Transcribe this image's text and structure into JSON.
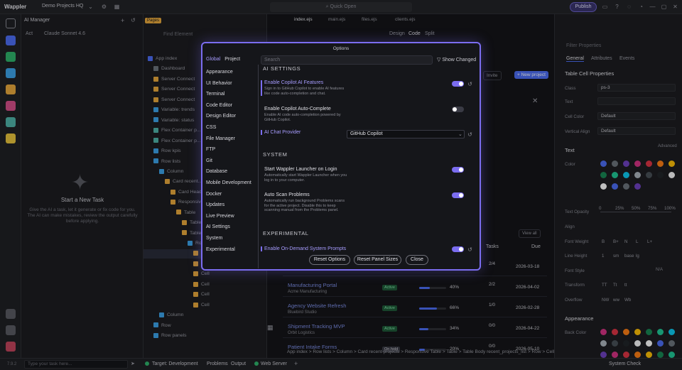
{
  "app": {
    "logo": "Wappler",
    "project": "Demo Projects HQ",
    "quick_open": "Quick Open",
    "publish": "Publish"
  },
  "ai_panel": {
    "title": "AI Manager",
    "mode": "Act",
    "model": "Claude Sonnet 4.6",
    "empty_title": "Start a New Task",
    "empty_desc": "Give the AI a task, let it generate or fix code for you. The AI can make mistakes, review the output carefully before applying.",
    "input_placeholder": "Type your task here..."
  },
  "tree": {
    "pages_badge": "Pages",
    "items": [
      {
        "label": "App index",
        "indent": 0
      },
      {
        "label": "Dashboard",
        "indent": 1
      },
      {
        "label": "Server Connect",
        "indent": 1
      },
      {
        "label": "Server Connect",
        "indent": 1
      },
      {
        "label": "Server Connect",
        "indent": 1
      },
      {
        "label": "Variable: trends",
        "indent": 1
      },
      {
        "label": "Variable: status",
        "indent": 1
      },
      {
        "label": "Flex Container p...",
        "indent": 1
      },
      {
        "label": "Flex Container p...",
        "indent": 1
      },
      {
        "label": "Row kpis",
        "indent": 1
      },
      {
        "label": "Row lists",
        "indent": 1
      },
      {
        "label": "Column",
        "indent": 2
      },
      {
        "label": "Card recent...",
        "indent": 3
      },
      {
        "label": "Card Head...",
        "indent": 4
      },
      {
        "label": "Responsive...",
        "indent": 4
      },
      {
        "label": "Table",
        "indent": 5
      },
      {
        "label": "Table He...",
        "indent": 6
      },
      {
        "label": "Table Bo...",
        "indent": 6
      },
      {
        "label": "Row",
        "indent": 7
      },
      {
        "label": "Cell",
        "indent": 8
      },
      {
        "label": "Cell",
        "indent": 8
      },
      {
        "label": "Cell",
        "indent": 8
      },
      {
        "label": "Cell",
        "indent": 8
      },
      {
        "label": "Cell",
        "indent": 8
      },
      {
        "label": "Cell",
        "indent": 8
      },
      {
        "label": "Column",
        "indent": 2
      },
      {
        "label": "Row",
        "indent": 1
      },
      {
        "label": "Row panels",
        "indent": 1
      }
    ]
  },
  "editor_tabs": [
    "index.ejs",
    "main.ejs",
    "files.ejs",
    "clients.ejs"
  ],
  "view_modes": [
    "Design",
    "Code",
    "Split"
  ],
  "canvas": {
    "new_project": "+ New project",
    "invite": "Invite",
    "view_all": "View all",
    "tasks_header": "Tasks",
    "due_header": "Due",
    "rows": [
      {
        "name": "",
        "client": "",
        "status": "",
        "progress": "",
        "tasks": "2/4",
        "due": "2026-03-18"
      },
      {
        "name": "Manufacturing Portal",
        "client": "Acme Manufacturing",
        "status": "Active",
        "progress": "40%",
        "tasks": "2/2",
        "due": "2026-04-02"
      },
      {
        "name": "Agency Website Refresh",
        "client": "Bluebird Studio",
        "status": "Active",
        "progress": "66%",
        "tasks": "1/0",
        "due": "2026-02-28"
      },
      {
        "name": "Shipment Tracking MVP",
        "client": "Orbit Logistics",
        "status": "Active",
        "progress": "34%",
        "tasks": "0/0",
        "due": "2026-04-22"
      },
      {
        "name": "Patient Intake Forms",
        "client": "",
        "status": "On hold",
        "progress": "20%",
        "tasks": "0/0",
        "due": "2026-05-10"
      }
    ],
    "breadcrumb": "App index > Row lists > Column > Card recent-projects > Responsive Table > Table > Table Body recent_projects_list > Row > Cell"
  },
  "right_panel": {
    "filter_placeholder": "Filter Properties",
    "tabs": [
      "General",
      "Attributes",
      "Events"
    ],
    "section_title": "Table Cell Properties",
    "class_label": "Class",
    "class_value": "ps-3",
    "text_label": "Text",
    "cell_color_label": "Cell Color",
    "cell_color_value": "Default",
    "valign_label": "Vertical Align",
    "valign_value": "Default",
    "text_section": "Text",
    "advanced": "Advanced",
    "color_label": "Color",
    "text_opacity_label": "Text Opacity",
    "opacity_ticks": [
      "0",
      "25%",
      "50%",
      "75%",
      "100%"
    ],
    "align_label": "Align",
    "font_weight_label": "Font Weight",
    "font_weights": [
      "B",
      "B+",
      "N",
      "L",
      "L+"
    ],
    "line_height_label": "Line Height",
    "line_heights": [
      "1",
      "sm",
      "base",
      "lg"
    ],
    "font_style_label": "Font Style",
    "font_style_na": "N/A",
    "transform_label": "Transform",
    "transforms": [
      "TT",
      "Tt",
      "tt"
    ],
    "overflow_label": "Overflow",
    "overflow_vals": [
      "NW",
      "ww",
      "Wb"
    ],
    "appearance_section": "Appearance",
    "back_color_label": "Back Color",
    "swatch_colors": [
      "#4c6ef5",
      "#6c757d",
      "#6f42c1",
      "#d63384",
      "#dc3545",
      "#fd7e14",
      "#ffc107",
      "#198754",
      "#20c997",
      "#0dcaf0",
      "#adb5bd",
      "#495057",
      "#212529",
      "#f8f9fa",
      "#ffffff"
    ]
  },
  "bottom": {
    "target_label": "Target: Development",
    "problems": "Problems",
    "output": "Output",
    "web_server": "Web Server",
    "system_check": "System Check",
    "version": "7.9.2"
  },
  "modal": {
    "title": "Options",
    "scope_tabs": [
      "Global",
      "Project"
    ],
    "search_placeholder": "Search",
    "show_changed": "Show Changed",
    "nav": [
      "Appearance",
      "UI Behavior",
      "Terminal",
      "Code Editor",
      "Design Editor",
      "CSS",
      "File Manager",
      "FTP",
      "Git",
      "Database",
      "Mobile Development",
      "Docker",
      "Updates",
      "Live Preview",
      "AI Settings",
      "System",
      "Experimental"
    ],
    "sections": {
      "ai": "AI SETTINGS",
      "system": "SYSTEM",
      "experimental": "EXPERIMENTAL"
    },
    "options": {
      "copilot_features": {
        "title": "Enable Copilot AI Features",
        "desc": "Sign in to GitHub Copilot to enable AI features like code auto-completion and chat."
      },
      "copilot_autocomplete": {
        "title": "Enable Copilot Auto-Complete",
        "desc": "Enable AI code auto-completion powered by GitHub Copilot."
      },
      "chat_provider": {
        "title": "AI Chat Provider",
        "value": "GitHub Copilot"
      },
      "launcher": {
        "title": "Start Wappler Launcher on Login",
        "desc": "Automatically start Wappler Launcher when you log in to your computer."
      },
      "autoscan": {
        "title": "Auto Scan Problems",
        "desc": "Automatically run background Problems scans for the active project. Disable this to keep scanning manual from the Problems panel."
      },
      "on_demand": {
        "title": "Enable On-Demand System Prompts"
      }
    },
    "buttons": {
      "reset_options": "Reset Options",
      "reset_panels": "Reset Panel Sizes",
      "close": "Close"
    },
    "accent": "#7b6df0"
  }
}
